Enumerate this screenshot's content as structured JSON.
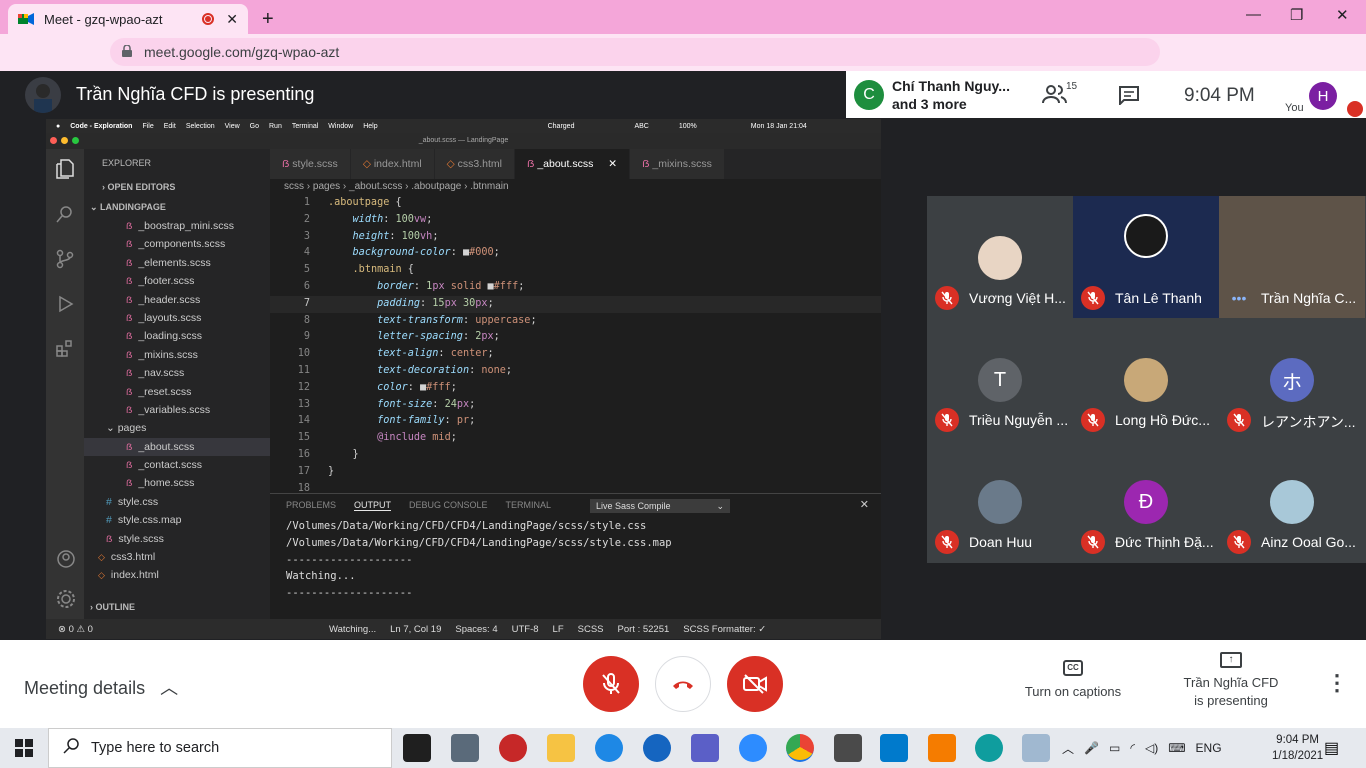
{
  "browser": {
    "tab_title": "Meet - gzq-wpao-azt",
    "url": "meet.google.com/gzq-wpao-azt",
    "profile_initial": "C"
  },
  "meet": {
    "presenter_banner": "Trần Nghĩa CFD is presenting",
    "chat_bubble": {
      "initial": "C",
      "line1": "Chí Thanh Nguy...",
      "line2": "and 3 more"
    },
    "people_count": "15",
    "time": "9:04  PM",
    "you_label": "You",
    "you_initial": "H"
  },
  "vscode": {
    "mac_menu": [
      "Code - Exploration",
      "File",
      "Edit",
      "Selection",
      "View",
      "Go",
      "Run",
      "Terminal",
      "Window",
      "Help"
    ],
    "mac_right": [
      "Charged",
      "100%",
      "ABC",
      "Mon 18 Jan  21:04"
    ],
    "window_title": "_about.scss — LandingPage",
    "explorer_title": "EXPLORER",
    "open_editors": "OPEN EDITORS",
    "project": "LANDINGPAGE",
    "files": [
      "_boostrap_mini.scss",
      "_components.scss",
      "_elements.scss",
      "_footer.scss",
      "_header.scss",
      "_layouts.scss",
      "_loading.scss",
      "_mixins.scss",
      "_nav.scss",
      "_reset.scss",
      "_variables.scss"
    ],
    "pages_folder": "pages",
    "page_files": [
      "_about.scss",
      "_contact.scss",
      "_home.scss"
    ],
    "root_files": [
      "style.css",
      "style.css.map",
      "style.scss"
    ],
    "html_files": [
      "css3.html",
      "index.html"
    ],
    "outline": "OUTLINE",
    "tabs": [
      "style.scss",
      "index.html",
      "css3.html",
      "_about.scss",
      "_mixins.scss"
    ],
    "breadcrumb": "scss  ›  pages  ›  _about.scss  ›  .aboutpage  ›  .btnmain",
    "panel_tabs": [
      "PROBLEMS",
      "OUTPUT",
      "DEBUG CONSOLE",
      "TERMINAL"
    ],
    "panel_select": "Live Sass Compile",
    "output": "/Volumes/Data/Working/CFD/CFD4/LandingPage/scss/style.css\n/Volumes/Data/Working/CFD/CFD4/LandingPage/scss/style.css.map\n--------------------\nWatching...\n--------------------",
    "status": {
      "errors": "⊗ 0  ⚠ 0",
      "watching": "Watching...",
      "position": "Ln 7, Col 19",
      "spaces": "Spaces: 4",
      "encoding": "UTF-8",
      "eol": "LF",
      "lang": "SCSS",
      "port": "Port : 52251",
      "formatter": "SCSS Formatter: ✓"
    }
  },
  "participants": [
    {
      "name": "Vương Việt H...",
      "initial": "",
      "color": "#e8d5c4"
    },
    {
      "name": "Tân Lê Thanh",
      "initial": "",
      "color": "#1a1a2e"
    },
    {
      "name": "Trần Nghĩa C...",
      "initial": "",
      "color": "#7a6a5a"
    },
    {
      "name": "Triều Nguyễn ...",
      "initial": "T",
      "color": "#5f6368"
    },
    {
      "name": "Long Hồ Đức...",
      "initial": "",
      "color": "#c8a878"
    },
    {
      "name": "レアンホアン...",
      "initial": "ホ",
      "color": "#5c6bc0"
    },
    {
      "name": "Doan Huu",
      "initial": "",
      "color": "#6a7a8a"
    },
    {
      "name": "Đức Thịnh Đặ...",
      "initial": "Đ",
      "color": "#9c27b0"
    },
    {
      "name": "Ainz Ooal Go...",
      "initial": "",
      "color": "#a8c8d8"
    }
  ],
  "bottom": {
    "meeting_details": "Meeting details",
    "captions": "Turn on captions",
    "presenting_line1": "Trần Nghĩa CFD",
    "presenting_line2": "is presenting"
  },
  "taskbar": {
    "search_placeholder": "Type here to search",
    "lang": "ENG",
    "time": "9:04 PM",
    "date": "1/18/2021"
  },
  "colors": {
    "meet_red": "#d93025",
    "tab_pink": "#f4a6d9"
  }
}
